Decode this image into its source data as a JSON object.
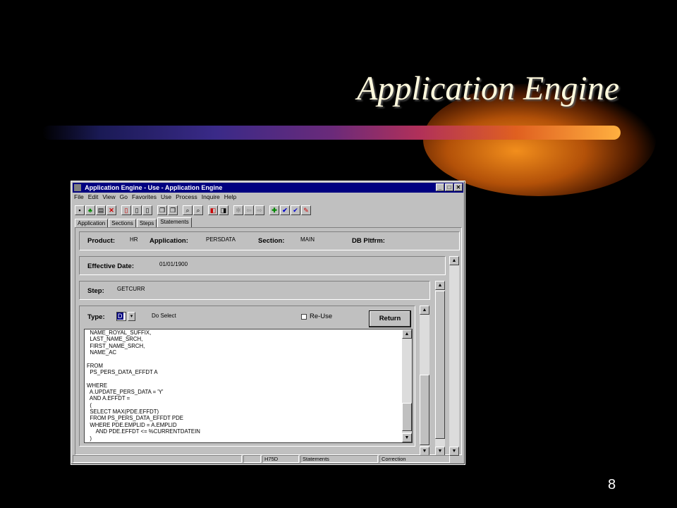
{
  "slide": {
    "title": "Application Engine",
    "number": "8"
  },
  "window": {
    "title": "Application Engine - Use - Application Engine",
    "controls": {
      "minimize": "_",
      "maximize": "□",
      "close": "✕"
    },
    "menu": [
      "File",
      "Edit",
      "View",
      "Go",
      "Favorites",
      "Use",
      "Process",
      "Inquire",
      "Help"
    ],
    "tabs": [
      "Application",
      "Sections",
      "Steps",
      "Statements"
    ],
    "active_tab": "Statements"
  },
  "header": {
    "product_label": "Product:",
    "product_value": "HR",
    "application_label": "Application:",
    "application_value": "PERSDATA",
    "section_label": "Section:",
    "section_value": "MAIN",
    "dbplatform_label": "DB Pltfrm:"
  },
  "effective": {
    "label": "Effective Date:",
    "value": "01/01/1900"
  },
  "step": {
    "label": "Step:",
    "value": "GETCURR"
  },
  "statement": {
    "type_label": "Type:",
    "type_value": "D",
    "type_desc": "Do Select",
    "reuse_label": "Re-Use",
    "return_label": "Return",
    "sql": "  NAME_ROYAL_SUFFIX,\n  LAST_NAME_SRCH,\n  FIRST_NAME_SRCH,\n  NAME_AC\n\nFROM\n  PS_PERS_DATA_EFFDT A\n\nWHERE\n  A.UPDATE_PERS_DATA = 'Y'\n  AND A.EFFDT =\n  (\n  SELECT MAX(PDE.EFFDT)\n  FROM PS_PERS_DATA_EFFDT PDE\n  WHERE PDE.EMPLID = A.EMPLID\n      AND PDE.EFFDT <= %CURRENTDATEIN\n  )"
  },
  "statusbar": {
    "db": "H75D",
    "panel": "Statements",
    "mode": "Correction"
  },
  "colors": {
    "titlebar": "#000080",
    "window": "#c0c0c0",
    "slide_bg": "#000000"
  }
}
